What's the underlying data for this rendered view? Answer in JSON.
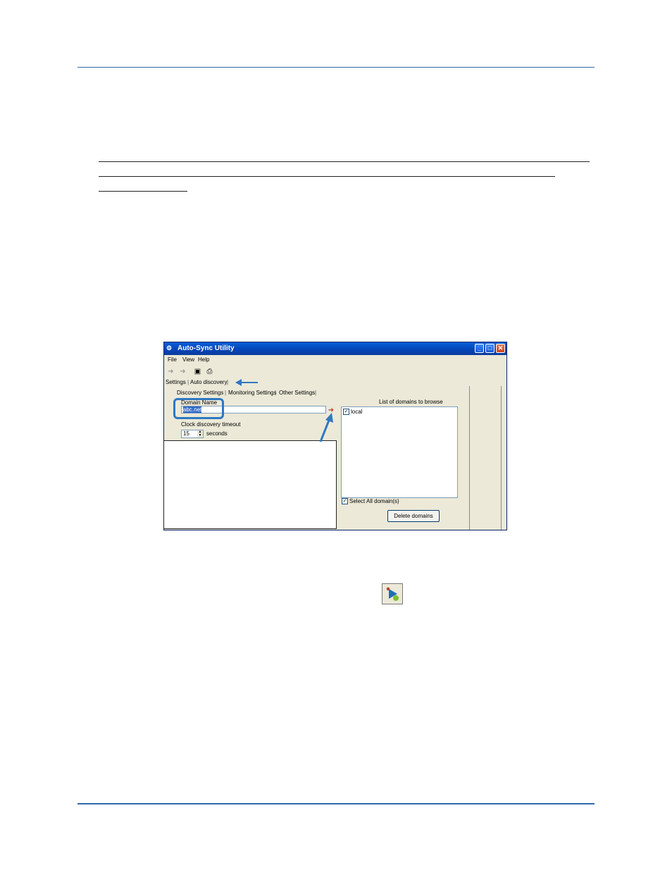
{
  "window": {
    "title": "Auto-Sync Utility",
    "menu": [
      "File",
      "View",
      "Help"
    ],
    "tabs_top": [
      "Settings",
      "Auto discovery"
    ],
    "tabs_sub": [
      "Discovery Settings",
      "Monitoring Settings",
      "Other Settings"
    ],
    "domain_label": "Domain Name",
    "domain_value": "abc.net",
    "timeout_label": "Clock discovery timeout",
    "timeout_value": "15",
    "timeout_unit": "seconds",
    "list_title": "List of domains to browse",
    "list_items": [
      {
        "label": "local",
        "checked": true
      }
    ],
    "select_all_label": "Select All domain(s)",
    "select_all_checked": true,
    "delete_button": "Delete domains"
  },
  "icons": {
    "app": "app-icon",
    "toolbar": [
      "discover-start-icon",
      "discover-stop-icon",
      "save-icon",
      "print-icon"
    ],
    "add_domain": "red-arrow-add-icon",
    "inline": "auto-discovery-play-icon"
  },
  "colors": {
    "rule": "#2e6aa8",
    "highlight": "#2f78c2",
    "titlebar": "#0443b5"
  }
}
